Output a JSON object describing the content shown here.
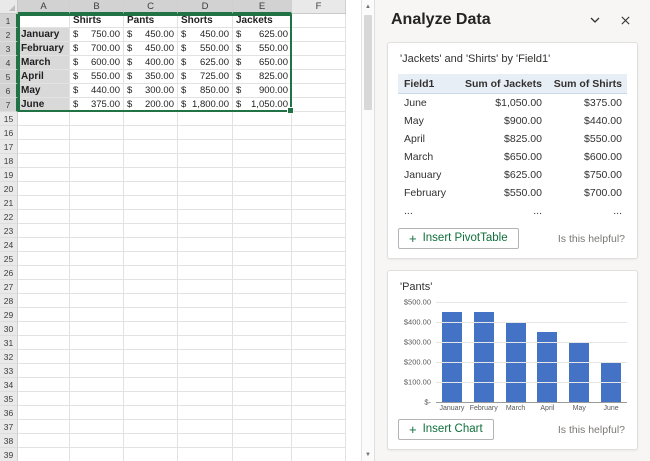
{
  "app": {
    "accent_green": "#217346",
    "bar_blue": "#4472C4"
  },
  "sheet": {
    "col_headers": [
      "A",
      "B",
      "C",
      "D",
      "E",
      "F"
    ],
    "selected_cols": [
      "A",
      "B",
      "C",
      "D",
      "E"
    ],
    "currency_symbol": "$",
    "header_row": {
      "n": "1",
      "labels": [
        "Shirts",
        "Pants",
        "Shorts",
        "Jackets"
      ]
    },
    "data_rows": [
      {
        "n": "2",
        "month": "January",
        "amounts": [
          "750.00",
          "450.00",
          "450.00",
          "625.00"
        ]
      },
      {
        "n": "3",
        "month": "February",
        "amounts": [
          "700.00",
          "450.00",
          "550.00",
          "550.00"
        ]
      },
      {
        "n": "4",
        "month": "March",
        "amounts": [
          "600.00",
          "400.00",
          "625.00",
          "650.00"
        ]
      },
      {
        "n": "5",
        "month": "April",
        "amounts": [
          "550.00",
          "350.00",
          "725.00",
          "825.00"
        ]
      },
      {
        "n": "6",
        "month": "May",
        "amounts": [
          "440.00",
          "300.00",
          "850.00",
          "900.00"
        ]
      },
      {
        "n": "7",
        "month": "June",
        "amounts": [
          "375.00",
          "200.00",
          "1,800.00",
          "1,050.00"
        ]
      }
    ],
    "empty_row_numbers": [
      15,
      16,
      17,
      18,
      19,
      20,
      21,
      22,
      23,
      24,
      25,
      26,
      27,
      28,
      29,
      30,
      31,
      32,
      33,
      34,
      35,
      36,
      37,
      38,
      39
    ]
  },
  "panel": {
    "title": "Analyze Data",
    "pivot_card": {
      "title": "'Jackets' and 'Shirts' by 'Field1'",
      "columns": [
        "Field1",
        "Sum of Jackets",
        "Sum of Shirts"
      ],
      "rows": [
        [
          "June",
          "$1,050.00",
          "$375.00"
        ],
        [
          "May",
          "$900.00",
          "$440.00"
        ],
        [
          "April",
          "$825.00",
          "$550.00"
        ],
        [
          "March",
          "$650.00",
          "$600.00"
        ],
        [
          "January",
          "$625.00",
          "$750.00"
        ],
        [
          "February",
          "$550.00",
          "$700.00"
        ]
      ],
      "ellipsis_row": [
        "...",
        "...",
        "..."
      ],
      "insert_label": "Insert PivotTable",
      "helpful_label": "Is this helpful?"
    },
    "chart_card": {
      "title": "'Pants'",
      "insert_label": "Insert Chart",
      "helpful_label": "Is this helpful?"
    }
  },
  "chart_data": {
    "type": "bar",
    "title": "'Pants'",
    "categories": [
      "January",
      "February",
      "March",
      "April",
      "May",
      "June"
    ],
    "values": [
      450,
      450,
      400,
      350,
      300,
      200
    ],
    "ylim": [
      0,
      500
    ],
    "ytick_labels": [
      "$500.00",
      "$400.00",
      "$300.00",
      "$200.00",
      "$100.00",
      "$-"
    ],
    "gridlines": true,
    "legend": false,
    "bar_color": "#4472C4"
  }
}
